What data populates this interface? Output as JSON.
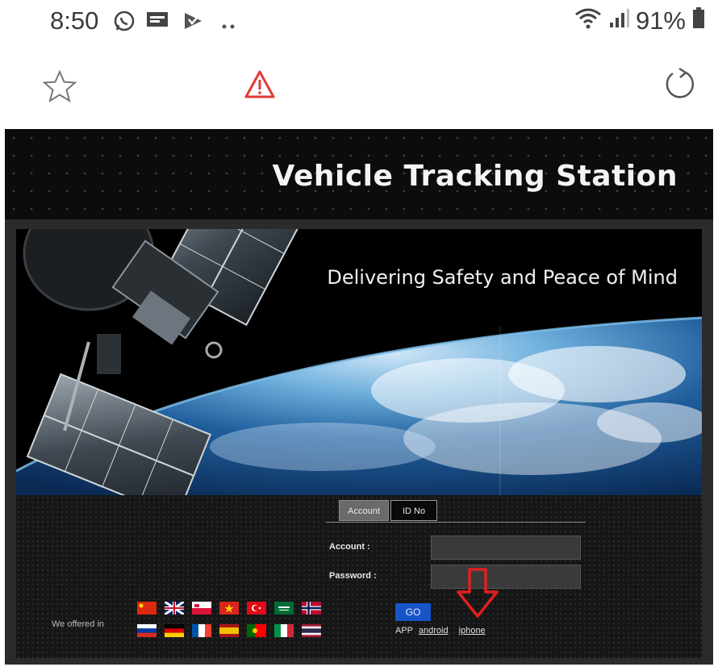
{
  "status_bar": {
    "time": "8:50",
    "icons": [
      "whatsapp-icon",
      "message-icon",
      "check-icon",
      "more-dots-icon"
    ],
    "battery_percent": "91%"
  },
  "browser_toolbar": {
    "icons": [
      "star-icon",
      "warning-icon",
      "reload-icon"
    ]
  },
  "page": {
    "title": "Vehicle Tracking Station",
    "tagline": "Delivering Safety and Peace of Mind",
    "login": {
      "tabs": [
        {
          "label": "Account",
          "active": true
        },
        {
          "label": "ID No",
          "active": false
        }
      ],
      "account_label": "Account :",
      "password_label": "Password :",
      "go_label": "GO",
      "app_label": "APP",
      "android_label": "android",
      "iphone_label": "iphone"
    },
    "languages_label": "We offered in",
    "flags_row1": [
      "china",
      "uk",
      "poland",
      "vietnam",
      "turkey",
      "saudi",
      "norway"
    ],
    "flags_row2": [
      "russia",
      "germany",
      "france",
      "spain",
      "portugal",
      "italy",
      "thailand"
    ]
  },
  "colors": {
    "warning": "#e53935",
    "arrow": "#e02020",
    "go_button": "#1654c8"
  }
}
